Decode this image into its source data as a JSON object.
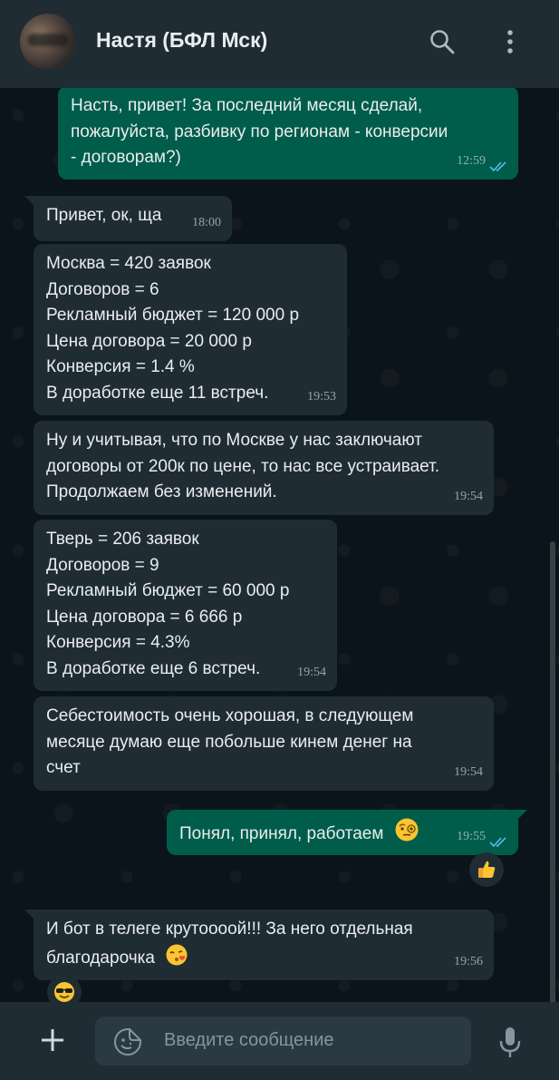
{
  "header": {
    "contact_name": "Настя (БФЛ Мск)",
    "icons": [
      "avatar",
      "search-icon",
      "more-vert-icon"
    ]
  },
  "messages": [
    {
      "direction": "out",
      "text": "Насть, привет! За последний месяц сделай,\nпожалуйста, разбивку по регионам - конверсии\n- договорам?)",
      "time": "12:59",
      "read": true
    },
    {
      "direction": "in",
      "text": "Привет, ок, ща",
      "time": "18:00"
    },
    {
      "direction": "in",
      "text": "Москва = 420 заявок\nДоговоров = 6\nРекламный бюджет = 120 000 р\nЦена договора = 20 000 р\nКонверсия = 1.4 %\nВ доработке еще 11 встреч.",
      "time": "19:53"
    },
    {
      "direction": "in",
      "text": "Ну и учитывая, что по Москве у нас заключают\nдоговоры от 200к по цене, то нас все устраивает.\nПродолжаем без изменений.",
      "time": "19:54"
    },
    {
      "direction": "in",
      "text": "Тверь = 206 заявок\nДоговоров = 9\nРекламный бюджет = 60 000 р\nЦена договора = 6 666 р\nКонверсия = 4.3%\nВ доработке еще 6 встреч.",
      "time": "19:54"
    },
    {
      "direction": "in",
      "text": "Себестоимость очень хорошая, в следующем\nмесяце думаю еще побольше кинем денег на\nсчет",
      "time": "19:54"
    },
    {
      "direction": "out",
      "text": "Понял, принял, работаем",
      "emoji": "face-with-monocle-emoji",
      "time": "19:55",
      "read": true,
      "reaction": "thumbs-up-emoji"
    },
    {
      "direction": "in",
      "text": "И бот в телеге крутоооой!!! За него отдельная\nблагодарочка",
      "emoji": "face-blowing-kiss-emoji",
      "time": "19:56",
      "reaction": "smiling-face-with-sunglasses-emoji"
    }
  ],
  "composer": {
    "placeholder": "Введите сообщение",
    "icons": [
      "plus-icon",
      "sticker-icon",
      "mic-icon"
    ]
  },
  "colors": {
    "header_bg": "#202c33",
    "chat_bg": "#0b141a",
    "incoming_bubble": "#202c33",
    "outgoing_bubble": "#005c4b",
    "read_tick": "#53bdeb",
    "text": "#e9edef",
    "muted": "#8696a0"
  }
}
